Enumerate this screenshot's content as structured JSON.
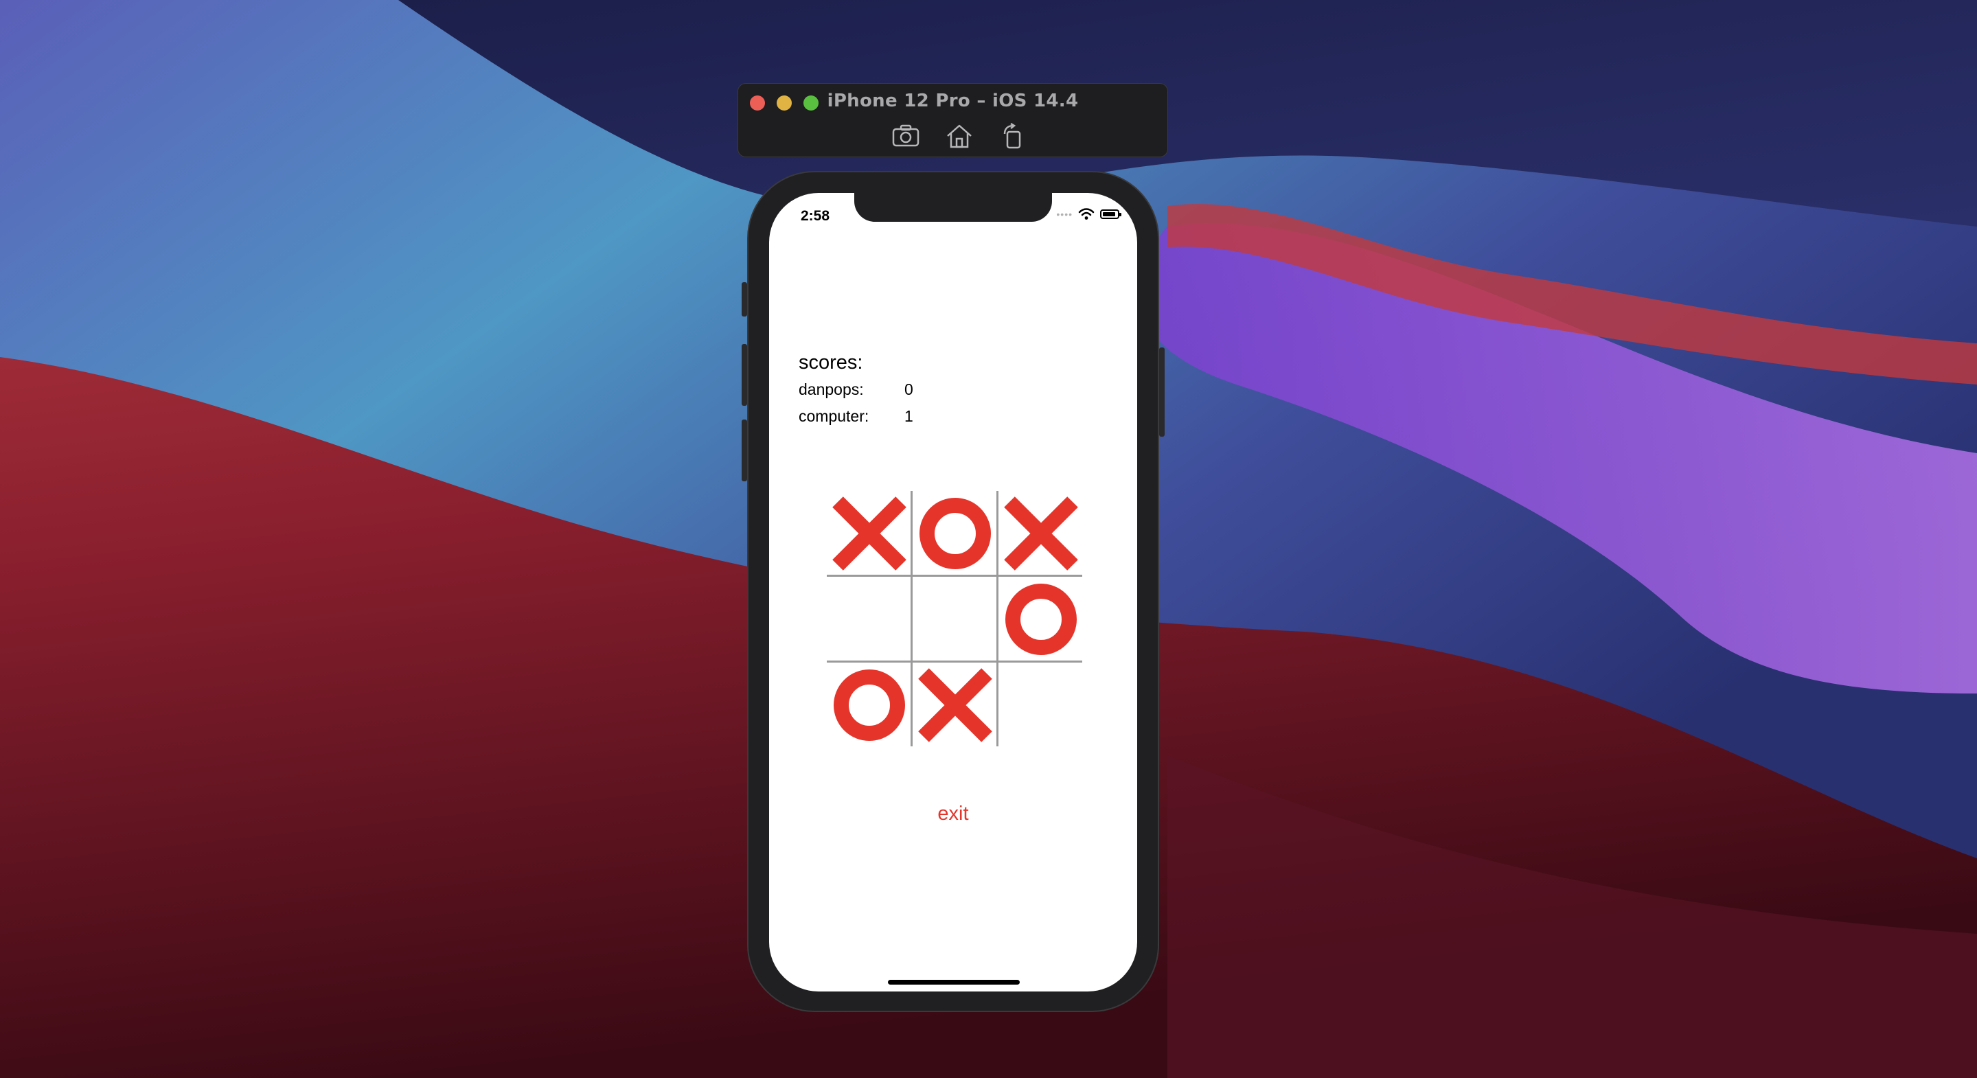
{
  "simulator": {
    "title": "iPhone 12 Pro – iOS 14.4",
    "tools": [
      "screenshot-icon",
      "home-icon",
      "rotate-icon"
    ]
  },
  "status_bar": {
    "time": "2:58"
  },
  "scores": {
    "title": "scores:",
    "players": [
      {
        "name": "danpops:",
        "score": "0"
      },
      {
        "name": "computer:",
        "score": "1"
      }
    ]
  },
  "board": {
    "cells": [
      "X",
      "O",
      "X",
      "",
      "",
      "O",
      "O",
      "X",
      ""
    ],
    "mark_color": "#e5352b",
    "grid_color": "#9a9a9a"
  },
  "exit_label": "exit",
  "colors": {
    "accent": "#e5352b"
  }
}
